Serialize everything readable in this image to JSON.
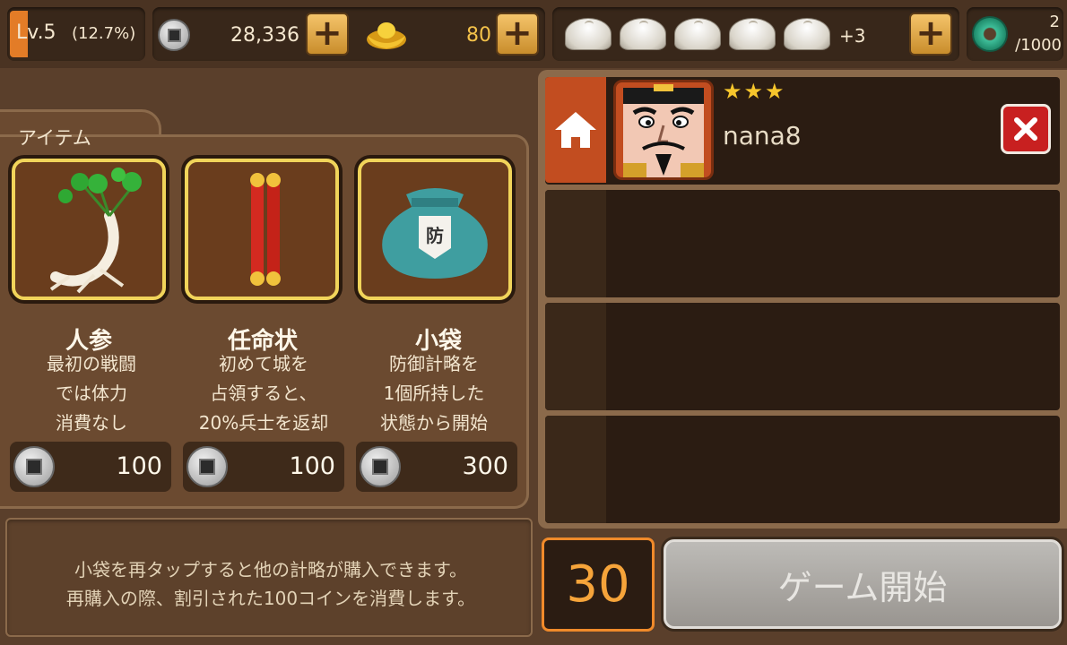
{
  "header": {
    "level_label": "Lv.5",
    "level_pct": "(12.7%)",
    "level_progress": 0.127,
    "coins": "28,336",
    "gold": "80",
    "buns_extra": "+3",
    "jade_count": "2",
    "jade_max": "/1000",
    "plus_symbol": "+"
  },
  "items_panel": {
    "title": "アイテム",
    "items": [
      {
        "name": "人参",
        "desc": [
          "最初の戦闘",
          "では体力",
          "消費なし"
        ],
        "price": "100",
        "icon": "ginseng-icon"
      },
      {
        "name": "任命状",
        "desc": [
          "初めて城を",
          "占領すると、",
          "20%兵士を返却"
        ],
        "price": "100",
        "icon": "scroll-icon"
      },
      {
        "name": "小袋",
        "desc": [
          "防御計略を",
          "1個所持した",
          "状態から開始"
        ],
        "price": "300",
        "icon": "pouch-icon",
        "badge": "防"
      }
    ]
  },
  "hint": {
    "line1": "小袋を再タップすると他の計略が購入できます。",
    "line2": "再購入の際、割引された100コインを消費します。"
  },
  "players": {
    "host": {
      "name": "nana8",
      "stars": "★★★"
    }
  },
  "footer": {
    "timer": "30",
    "start_label": "ゲーム開始"
  },
  "colors": {
    "accent_orange": "#f08a2a",
    "gold_border": "#f1d45a",
    "close_red": "#c82020"
  }
}
